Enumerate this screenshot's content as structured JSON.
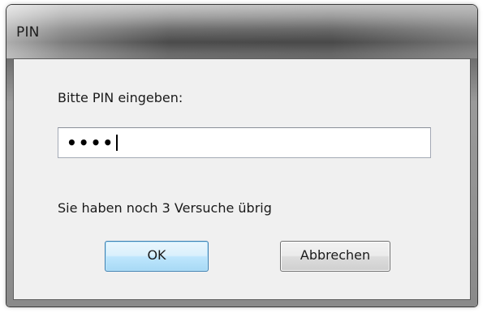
{
  "window": {
    "title": "PIN"
  },
  "dialog": {
    "prompt_label": "Bitte PIN eingeben:",
    "pin_masked_value": "••••",
    "attempts_text": "Sie haben noch 3 Versuche übrig",
    "ok_label": "OK",
    "cancel_label": "Abbrechen"
  },
  "colors": {
    "client_background": "#f0f0f0",
    "ok_button_border": "#3c7fb1",
    "cancel_button_border": "#707070"
  }
}
